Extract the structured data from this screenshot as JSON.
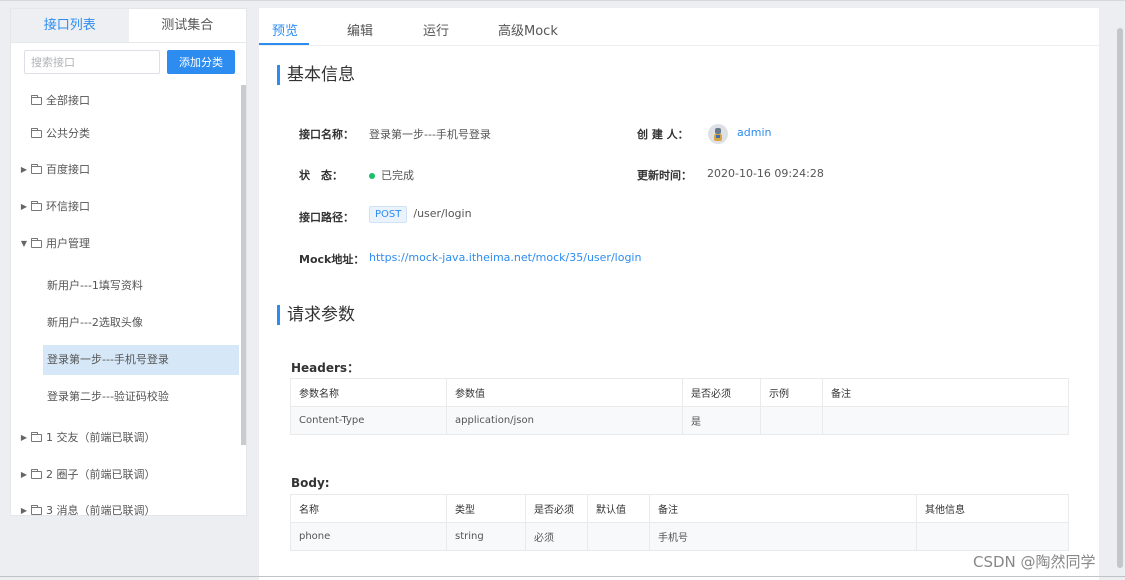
{
  "left_panel": {
    "tabs": [
      "接口列表",
      "测试集合"
    ],
    "search_placeholder": "搜索接口",
    "add_category_label": "添加分类",
    "tree": [
      {
        "label": "全部接口",
        "caret": ""
      },
      {
        "label": "公共分类",
        "caret": ""
      },
      {
        "label": "百度接口",
        "caret": "▶"
      },
      {
        "label": "环信接口",
        "caret": "▶"
      },
      {
        "label": "用户管理",
        "caret": "▼"
      }
    ],
    "children": [
      "新用户---1填写资料",
      "新用户---2选取头像",
      "登录第一步---手机号登录",
      "登录第二步---验证码校验"
    ],
    "tree_after": [
      {
        "label": "1 交友（前端已联调）",
        "caret": "▶"
      },
      {
        "label": "2 圈子（前端已联调）",
        "caret": "▶"
      },
      {
        "label": "3 消息（前端已联调）",
        "caret": "▶"
      }
    ]
  },
  "right_panel": {
    "tabs": [
      "预览",
      "编辑",
      "运行",
      "高级Mock"
    ],
    "basic_info_title": "基本信息",
    "fields": {
      "name_label": "接口名称：",
      "name_value": "登录第一步---手机号登录",
      "creator_label": "创 建 人：",
      "creator_value": "admin",
      "status_label": "状　态：",
      "status_value": "已完成",
      "updated_label": "更新时间：",
      "updated_value": "2020-10-16 09:24:28",
      "path_label": "接口路径：",
      "method": "POST",
      "path_value": "/user/login",
      "mock_label": "Mock地址：",
      "mock_value": "https://mock-java.itheima.net/mock/35/user/login"
    },
    "request_title": "请求参数",
    "headers_label": "Headers：",
    "headers_table": {
      "columns": [
        "参数名称",
        "参数值",
        "是否必须",
        "示例",
        "备注"
      ],
      "rows": [
        [
          "Content-Type",
          "application/json",
          "是",
          "",
          ""
        ]
      ]
    },
    "body_label": "Body:",
    "body_table": {
      "columns": [
        "名称",
        "类型",
        "是否必须",
        "默认值",
        "备注",
        "其他信息"
      ],
      "rows": [
        [
          "phone",
          "string",
          "必须",
          "",
          "手机号",
          ""
        ]
      ]
    }
  },
  "watermark": "CSDN @陶然同学",
  "colors": {
    "accent": "#2d8cf0",
    "status_done": "#19be6b",
    "selected_bg": "#d6e8f8"
  }
}
